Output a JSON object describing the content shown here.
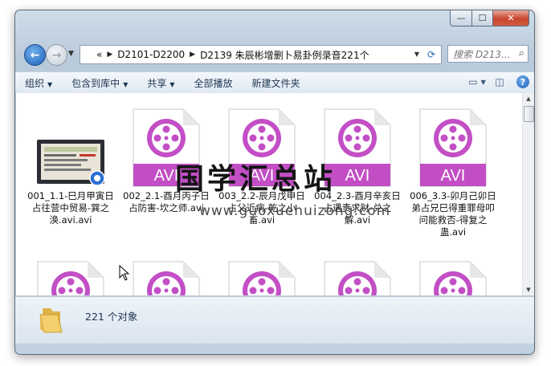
{
  "window": {
    "controls": {
      "minimize": "—",
      "maximize": "☐",
      "close": "✕"
    }
  },
  "nav": {
    "address": {
      "overflow": "«",
      "crumbs": [
        "D2101-D2200",
        "D2139 朱辰彬增删卜易卦例录音221个"
      ]
    },
    "search_placeholder": "搜索 D213..."
  },
  "toolbar": {
    "items": [
      {
        "label": "组织",
        "dropdown": true
      },
      {
        "label": "包含到库中",
        "dropdown": true
      },
      {
        "label": "共享",
        "dropdown": true
      },
      {
        "label": "全部播放",
        "dropdown": false
      },
      {
        "label": "新建文件夹",
        "dropdown": false
      }
    ]
  },
  "files": [
    {
      "name": "001_1.1-巳月甲寅日占往营中贸易-巽之涣.avi.avi",
      "type": "video-thumbnail"
    },
    {
      "name": "002_2.1-酉月丙子日占防害-坎之师.avi",
      "type": "avi"
    },
    {
      "name": "003_2.2-辰月戊申日占父近病-乾之小畜.avi",
      "type": "avi"
    },
    {
      "name": "004_2.3-酉月辛亥日占遇责求财-兑之解.avi",
      "type": "avi"
    },
    {
      "name": "006_3.3-卯月己卯日弟占兄巳得重罪母叩问能救否-得复之蛊.avi",
      "type": "avi"
    },
    {
      "name": "",
      "type": "avi"
    },
    {
      "name": "",
      "type": "avi"
    },
    {
      "name": "",
      "type": "avi"
    },
    {
      "name": "",
      "type": "avi"
    },
    {
      "name": "",
      "type": "avi"
    }
  ],
  "icon_text": "AVI",
  "watermark": {
    "title": "国学汇总站",
    "url": "www.guoxuehuizong.com"
  },
  "details": {
    "count_label": "221 个对象"
  },
  "colors": {
    "avi_purple": "#c34fc6",
    "avi_band": "#c24ec5",
    "nav_blue": "#1f5fb6"
  }
}
